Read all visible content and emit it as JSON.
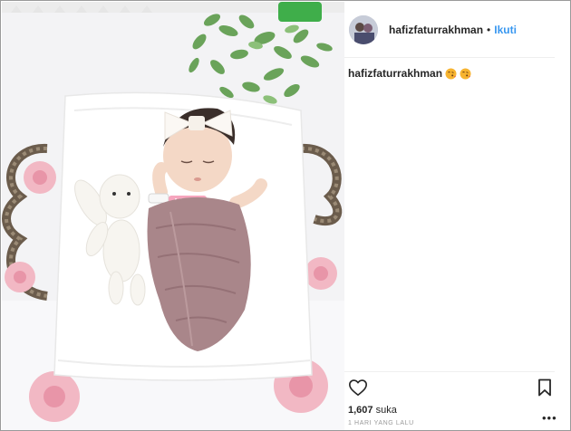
{
  "post": {
    "photo_alt": "newborn baby photo",
    "author": {
      "username": "hafizfaturrakhman",
      "separator": "•",
      "follow_label": "Ikuti"
    },
    "caption": {
      "username": "hafizfaturrakhman",
      "emojis": [
        "face-blowing-kiss",
        "face-blowing-kiss"
      ]
    },
    "likes": {
      "count": "1,607",
      "word": "suka"
    },
    "timestamp": "1 HARI YANG LALU",
    "more_label": "•••"
  },
  "colors": {
    "link_blue": "#3897f0",
    "text": "#262626",
    "muted": "#999999",
    "divider": "#efefef"
  },
  "icons": {
    "like": "heart-icon",
    "save": "bookmark-icon",
    "more": "more-options-icon"
  }
}
